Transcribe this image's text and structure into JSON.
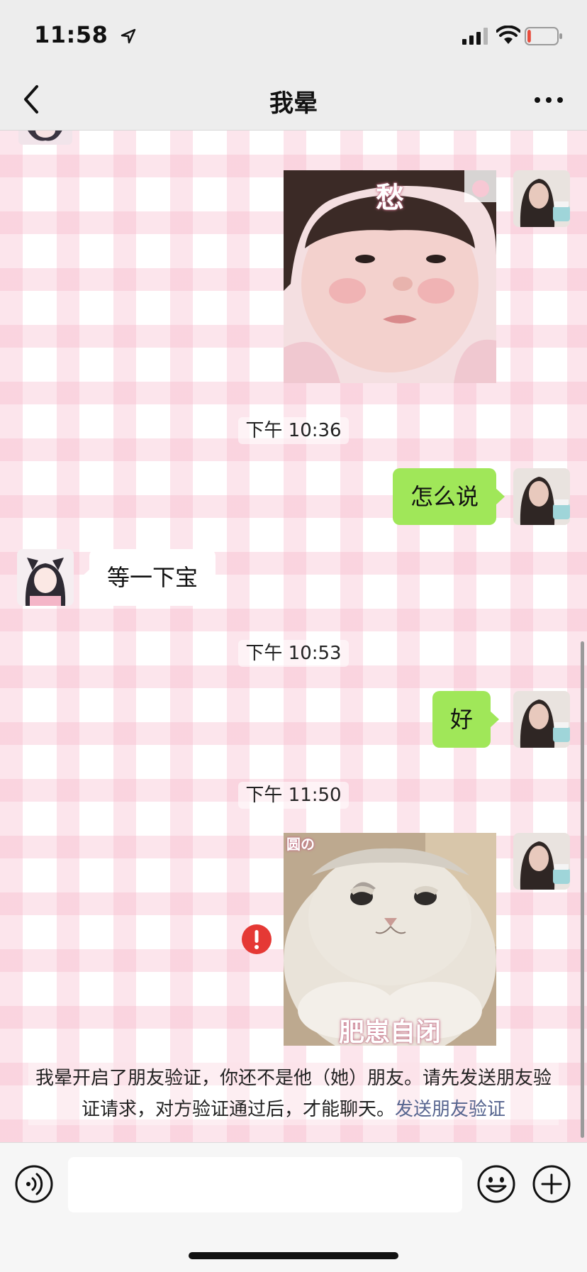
{
  "status_bar": {
    "time": "11:58",
    "battery_level": 0.12,
    "battery_color": "#e74c3c"
  },
  "nav": {
    "title": "我晕"
  },
  "messages": {
    "timestamp_1": "下午 10:36",
    "self_text_1": "怎么说",
    "friend_text_1": "等一下宝",
    "timestamp_2": "下午 10:53",
    "self_text_2": "好",
    "timestamp_3": "下午 11:50",
    "sticker_1_caption": "愁",
    "sticker_2_corner": "圆の",
    "sticker_2_caption": "肥崽自闭",
    "failed_icon": "exclamation-icon"
  },
  "system_notice": {
    "text": "我晕开启了朋友验证，你还不是他（她）朋友。请先发送朋友验证请求，对方验证通过后，才能聊天。",
    "link": "发送朋友验证"
  },
  "input_bar": {
    "placeholder": "",
    "icons": [
      "voice-icon",
      "emoji-icon",
      "plus-icon"
    ]
  },
  "colors": {
    "self_bubble": "#a0e759",
    "friend_bubble": "#ffffff",
    "link": "#56658f",
    "error": "#e53935"
  }
}
